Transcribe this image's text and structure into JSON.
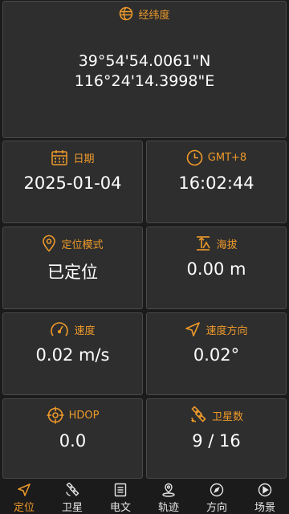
{
  "coordinates": {
    "title": "经纬度",
    "latitude": "39°54'54.0061\"N",
    "longitude": "116°24'14.3998\"E"
  },
  "date": {
    "label": "日期",
    "value": "2025-01-04"
  },
  "time": {
    "label": "GMT+8",
    "value": "16:02:44"
  },
  "fix_mode": {
    "label": "定位模式",
    "value": "已定位"
  },
  "altitude": {
    "label": "海拔",
    "value": "0.00 m"
  },
  "speed": {
    "label": "速度",
    "value": "0.02 m/s"
  },
  "heading": {
    "label": "速度方向",
    "value": "0.02°"
  },
  "hdop": {
    "label": "HDOP",
    "value": "0.0"
  },
  "satellites": {
    "label": "卫星数",
    "value": "9 / 16"
  },
  "nav": {
    "items": [
      {
        "label": "定位",
        "icon": "location-arrow-icon",
        "active": true
      },
      {
        "label": "卫星",
        "icon": "satellite-icon",
        "active": false
      },
      {
        "label": "电文",
        "icon": "document-icon",
        "active": false
      },
      {
        "label": "轨迹",
        "icon": "track-pin-icon",
        "active": false
      },
      {
        "label": "方向",
        "icon": "compass-icon",
        "active": false
      },
      {
        "label": "场景",
        "icon": "play-circle-icon",
        "active": false
      }
    ]
  },
  "colors": {
    "accent": "#ee9a2a",
    "card": "#2e2e2e",
    "border": "#4a4a4a",
    "background": "#1b1b1b"
  }
}
